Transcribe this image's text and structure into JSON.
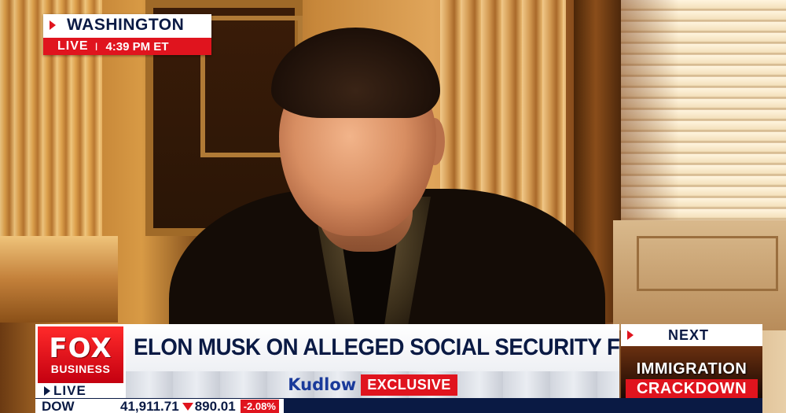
{
  "location_bug": {
    "city": "WASHINGTON",
    "live_label": "LIVE",
    "separator": "I",
    "time": "4:39 PM ET"
  },
  "network_logo": {
    "line1": "FOX",
    "line2": "BUSINESS",
    "live_label": "LIVE"
  },
  "headline": {
    "text": "ELON MUSK ON ALLEGED SOCIAL SECURITY FRAUD"
  },
  "subheadline": {
    "show": "Kudlow",
    "badge": "EXCLUSIVE"
  },
  "up_next": {
    "label": "NEXT",
    "title_line1": "IMMIGRATION",
    "title_line2": "CRACKDOWN"
  },
  "ticker": {
    "index": "DOW",
    "value": "41,911.71",
    "change": "890.01",
    "percent": "-2.08%",
    "direction": "down"
  },
  "colors": {
    "fox_red": "#e0141e",
    "navy": "#0a1a44",
    "white": "#ffffff"
  },
  "icons": {
    "live_marker": "triangle-right-icon",
    "ticker_down": "triangle-down-icon"
  }
}
